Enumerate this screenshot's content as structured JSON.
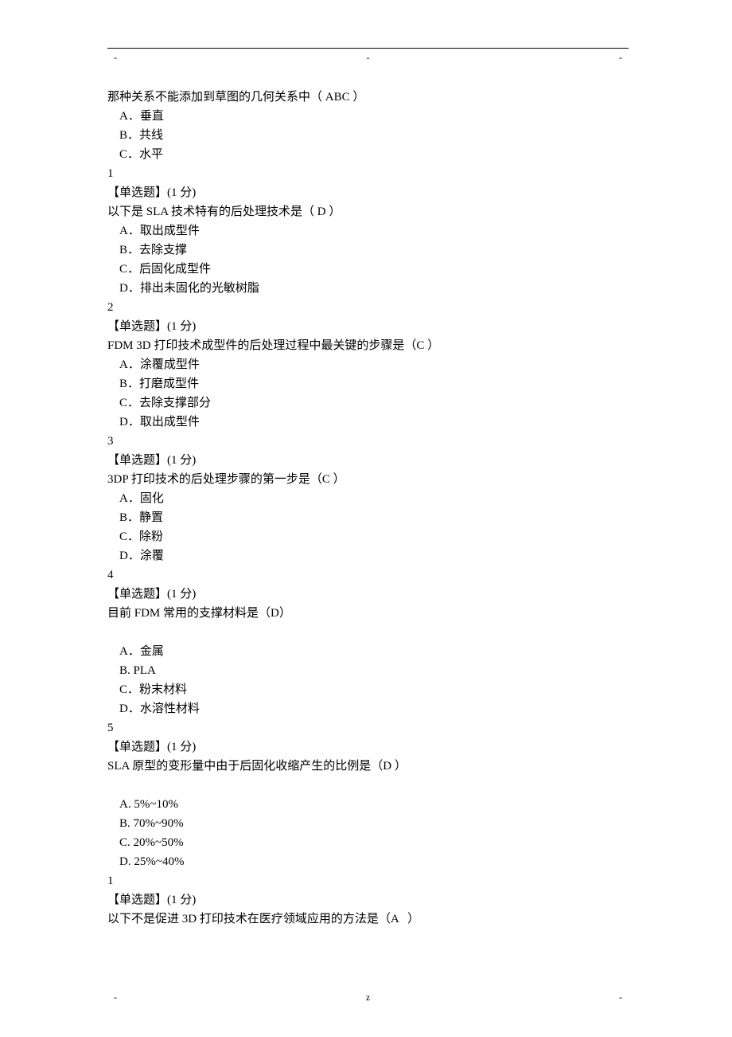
{
  "header": {
    "m1": "-",
    "m2": "-",
    "m3": "-"
  },
  "footer": {
    "m1": "-",
    "m2": "z",
    "m3": "-"
  },
  "q_prev": {
    "stem": "那种关系不能添加到草图的几何关系中（ ABC ）",
    "A": "A．垂直",
    "B": "B．共线",
    "C": "C．水平"
  },
  "q1": {
    "num": "1",
    "type": "【单选题】(1 分)",
    "stem": "以下是 SLA 技术特有的后处理技术是（ D ）",
    "A": "A．取出成型件",
    "B": "B．去除支撑",
    "C": "C．后固化成型件",
    "D": "D．排出未固化的光敏树脂"
  },
  "q2": {
    "num": "2",
    "type": "【单选题】(1 分)",
    "stem": "FDM 3D 打印技术成型件的后处理过程中最关键的步骤是（C ）",
    "A": "A．涂覆成型件",
    "B": "B．打磨成型件",
    "C": "C．去除支撑部分",
    "D": "D．取出成型件"
  },
  "q3": {
    "num": "3",
    "type": "【单选题】(1 分)",
    "stem": "3DP 打印技术的后处理步骤的第一步是（C ）",
    "A": "A．固化",
    "B": "B．静置",
    "C": "C．除粉",
    "D": "D．涂覆"
  },
  "q4": {
    "num": "4",
    "type": "【单选题】(1 分)",
    "stem": "目前 FDM 常用的支撑材料是（D）",
    "A": "A．金属",
    "B": "B. PLA",
    "C": "C．粉末材料",
    "D": "D．水溶性材料"
  },
  "q5": {
    "num": "5",
    "type": "【单选题】(1 分)",
    "stem": "SLA 原型的变形量中由于后固化收缩产生的比例是（D ）",
    "A": "A. 5%~10%",
    "B": "B. 70%~90%",
    "C": "C. 20%~50%",
    "D": "D. 25%~40%"
  },
  "q6": {
    "num": "1",
    "type": "【单选题】(1 分)",
    "stem": "以下不是促进 3D 打印技术在医疗领域应用的方法是（A   ）"
  }
}
